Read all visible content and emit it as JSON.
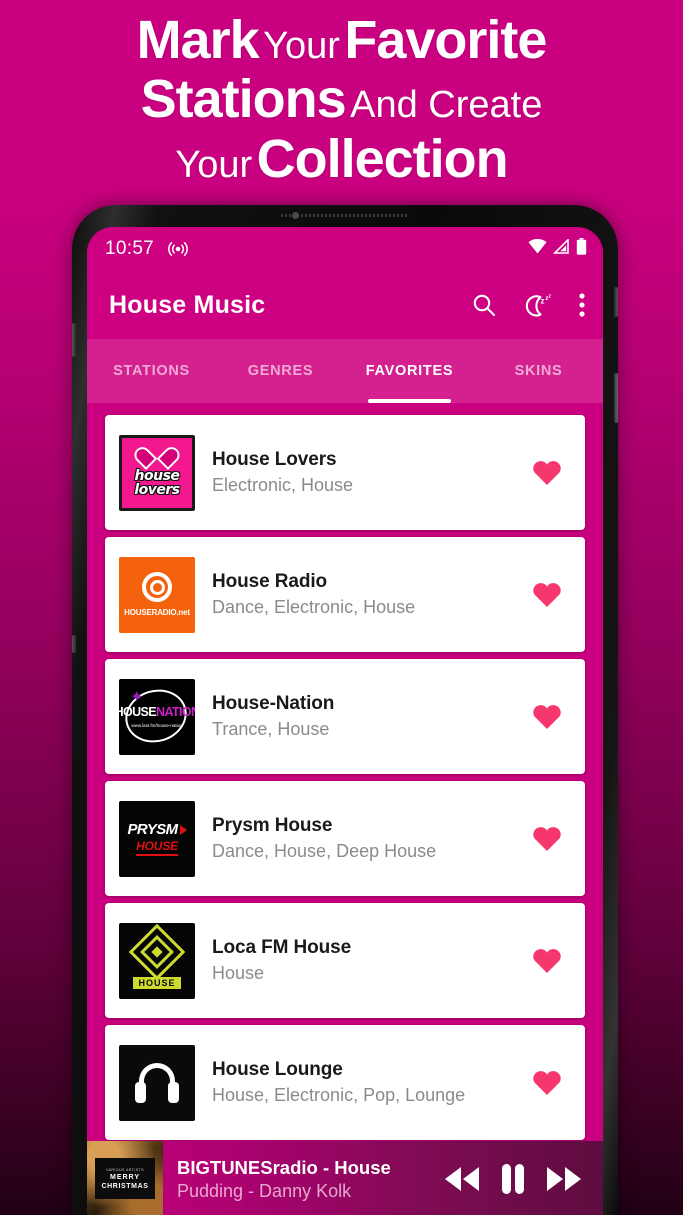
{
  "headline": {
    "line1_bold_a": "Mark",
    "line1_light": "Your",
    "line1_bold_b": "Favorite",
    "line2_bold": "Stations",
    "line2_light": "And Create",
    "line3_light": "Your",
    "line3_bold": "Collection"
  },
  "status_bar": {
    "time": "10:57",
    "cast_icon": "broadcast-icon",
    "wifi_icon": "wifi-icon",
    "signal_icon": "signal-icon",
    "battery_icon": "battery-icon"
  },
  "app_bar": {
    "title": "House Music",
    "search_icon": "search-icon",
    "sleep_timer_icon": "sleep-timer-moon-icon",
    "overflow_icon": "overflow-menu-icon"
  },
  "tabs": [
    {
      "label": "STATIONS",
      "active": false
    },
    {
      "label": "GENRES",
      "active": false
    },
    {
      "label": "FAVORITES",
      "active": true
    },
    {
      "label": "SKINS",
      "active": false
    }
  ],
  "stations": [
    {
      "name": "House Lovers",
      "genres": "Electronic, House",
      "logo_text_1": "house",
      "logo_text_2": "lovers",
      "favorited": true
    },
    {
      "name": "House Radio",
      "genres": "Dance, Electronic, House",
      "logo_text_1": "HOUSERADIO.net",
      "logo_text_2": "",
      "favorited": true
    },
    {
      "name": "House-Nation",
      "genres": "Trance, House",
      "logo_text_1": "HOUSE",
      "logo_text_2": "NATION",
      "logo_text_3": "www.last.fm/house-nation",
      "favorited": true
    },
    {
      "name": "Prysm House",
      "genres": "Dance, House, Deep House",
      "logo_text_1": "PRYSM",
      "logo_text_2": "HOUSE",
      "favorited": true
    },
    {
      "name": "Loca FM House",
      "genres": "House",
      "logo_text_1": "HOUSE",
      "logo_text_2": "",
      "favorited": true
    },
    {
      "name": "House Lounge",
      "genres": "House, Electronic, Pop, Lounge",
      "logo_text_1": "headphones-icon",
      "logo_text_2": "",
      "favorited": true
    }
  ],
  "player": {
    "title": "BIGTUNESradio - House",
    "subtitle": "Pudding - Danny Kolk",
    "album_artists_label": "VARIOUS ARTISTS",
    "album_title_line1": "MERRY",
    "album_title_line2": "CHRISTMAS",
    "rewind_icon": "rewind-icon",
    "pause_icon": "pause-icon",
    "forward_icon": "fast-forward-icon"
  },
  "colors": {
    "brand_magenta": "#cc0081",
    "tab_bar": "#d4218f",
    "heart_pink": "#f5376e",
    "bg_top": "#c9007f",
    "bg_bottom": "#200114",
    "card_white": "#ffffff",
    "genre_gray": "#8b8b8b"
  }
}
